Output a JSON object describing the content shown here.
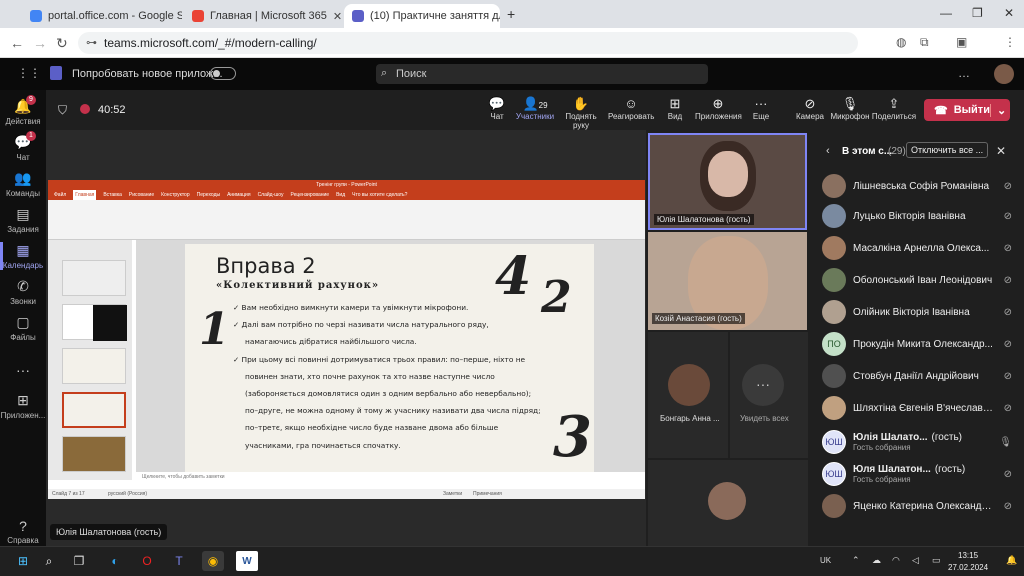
{
  "browser": {
    "tabs": [
      {
        "label": "portal.office.com - Google Sea",
        "color": "#4285f4"
      },
      {
        "label": "Главная | Microsoft 365",
        "color": "#ea4335"
      },
      {
        "label": "(10) Практичне заняття дл",
        "color": "#5b5fc7"
      }
    ],
    "new_tab": "+",
    "url": "teams.microsoft.com/_#/modern-calling/"
  },
  "teams": {
    "new_app": "Попробовать новое прилож...",
    "search_placeholder": "Поиск",
    "timer": "40:52",
    "rail": [
      {
        "label": "Действия",
        "icon": "bell-icon",
        "badge": "9"
      },
      {
        "label": "Чат",
        "icon": "chat-icon",
        "badge": "1"
      },
      {
        "label": "Команды",
        "icon": "teams-icon",
        "badge": ""
      },
      {
        "label": "Задания",
        "icon": "assignment-icon",
        "badge": ""
      },
      {
        "label": "Календарь",
        "icon": "calendar-icon",
        "badge": ""
      },
      {
        "label": "Звонки",
        "icon": "phone-icon",
        "badge": ""
      },
      {
        "label": "Файлы",
        "icon": "file-icon",
        "badge": ""
      },
      {
        "label": "Приложен...",
        "icon": "apps-icon",
        "badge": ""
      },
      {
        "label": "Справка",
        "icon": "help-icon",
        "badge": ""
      }
    ],
    "tools": [
      {
        "label": "Чат",
        "icon": "chat-icon"
      },
      {
        "label": "Участники",
        "icon": "people-icon",
        "count": "29"
      },
      {
        "label": "Поднять руку",
        "icon": "hand-icon"
      },
      {
        "label": "Реагировать",
        "icon": "emoji-icon"
      },
      {
        "label": "Вид",
        "icon": "grid-icon"
      },
      {
        "label": "Приложения",
        "icon": "plus-icon"
      },
      {
        "label": "Еще",
        "icon": "more-icon"
      },
      {
        "label": "Камера",
        "icon": "camera-off-icon"
      },
      {
        "label": "Микрофон",
        "icon": "mic-off-icon"
      },
      {
        "label": "Поделиться",
        "icon": "share-icon"
      }
    ],
    "leave": "Выйти",
    "presenter": "Юлія Шалатонова (гость)"
  },
  "ppt": {
    "title": "Тренінг групи  -  PowerPoint",
    "menu": [
      "Файл",
      "Главная",
      "Вставка",
      "Рисование",
      "Конструктор",
      "Переходы",
      "Анимация",
      "Слайд-шоу",
      "Рецензирование",
      "Вид",
      "Что вы хотите сделать?"
    ],
    "notes": "Щелкните, чтобы добавить заметки",
    "status_left": "Слайд 7 из 17",
    "status_lang": "русский (Россия)",
    "status_notes": "Заметки",
    "status_comments": "Примечания"
  },
  "slide": {
    "title": "Вправа 2",
    "subtitle": "«Колективний рахунок»",
    "n1": "1",
    "n2": "2",
    "n3": "3",
    "n4": "4",
    "lines": [
      "✓ Вам необхідно вимкнути камери та увімкнути мікрофони.",
      "✓ Далі вам потрібно по черзі називати числа натурального ряду,",
      "намагаючись дібратися найбільшого числа.",
      "✓ При цьому всі повинні дотримуватися трьох правил: по–перше, ніхто не",
      "повинен знати, хто почне рахунок та хто назве наступне число",
      "(зaбороняється домовлятися один з одним вербально або невербально);",
      "по–друге, не можна одному й тому ж учаснику називати два числа підряд;",
      "по–третє, якщо необхідне число буде назване двома або більше",
      "учасниками, гра починається спочатку."
    ]
  },
  "videos": [
    {
      "name": "Юлія Шалатонова (гость)"
    },
    {
      "name": "Козій Анастасия (гость)"
    },
    {
      "name": "Бонгарь Анна ..."
    },
    {
      "name": "Увидеть всех"
    }
  ],
  "panel": {
    "title": "В этом с...",
    "count": "(29)",
    "mute_all": "Отключить все ...",
    "people": [
      {
        "name": "Лішневська Софія Романівна",
        "color": "#8a7060",
        "initials": ""
      },
      {
        "name": "Луцько Вікторія Іванівна",
        "color": "#7a8aa0",
        "initials": ""
      },
      {
        "name": "Масалкіна Арнелла Олекса...",
        "color": "#a07a60",
        "initials": ""
      },
      {
        "name": "Оболонський Іван Леонідович",
        "color": "#6a7a5a",
        "initials": ""
      },
      {
        "name": "Олійник Вікторія Іванівна",
        "color": "#b0a090",
        "initials": ""
      },
      {
        "name": "Прокудін Микита Олександр...",
        "color": "#c4e0c8",
        "initials": "ПО"
      },
      {
        "name": "Стовбун Даніїл Андрійович",
        "color": "#505050",
        "initials": ""
      },
      {
        "name": "Шляхтіна Євгенія В'ячеславів...",
        "color": "#c0a080",
        "initials": ""
      },
      {
        "name": "Юлія Шалато...",
        "color": "#e0e4f8",
        "initials": "ЮШ",
        "role": "(гость)",
        "sub": "Гость собрания"
      },
      {
        "name": "Юля Шалатон...",
        "color": "#e0e4f8",
        "initials": "ЮШ",
        "role": "(гость)",
        "sub": "Гость собрания"
      },
      {
        "name": "Яценко Катерина Олександрі...",
        "color": "#7a6050",
        "initials": ""
      }
    ]
  },
  "taskbar": {
    "lang": "UK",
    "time": "13:15",
    "date": "27.02.2024"
  }
}
